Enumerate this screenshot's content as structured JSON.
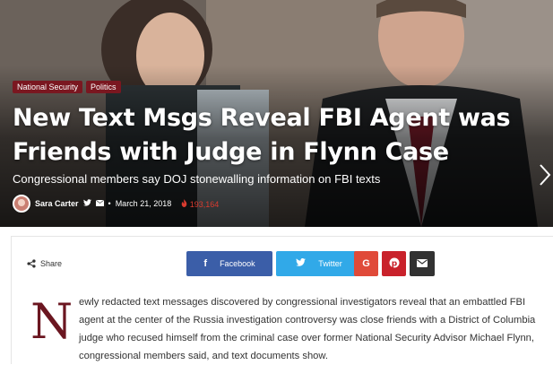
{
  "hero": {
    "categories": [
      "National Security",
      "Politics"
    ],
    "title": "New Text Msgs Reveal FBI Agent was Friends with Judge in Flynn Case",
    "subtitle": "Congressional members say DOJ stonewalling information on FBI texts",
    "author": "Sara Carter",
    "date": "March 21, 2018",
    "views": "193,164",
    "next_icon": "chevron-right-icon"
  },
  "share": {
    "label": "Share",
    "facebook": "Facebook",
    "twitter": "Twitter"
  },
  "article": {
    "dropcap": "N",
    "paragraph": "ewly redacted text messages discovered by congressional investigators reveal that an embattled FBI agent at the center of the Russia investigation controversy was close friends with a District of Columbia judge who recused himself from the criminal case over former National Security Advisor Michael Flynn, congressional members said, and text documents show."
  },
  "colors": {
    "category_bg": "#7a1720",
    "facebook": "#3b5ea8",
    "twitter": "#31a9e8",
    "google_plus": "#e04a39",
    "pinterest": "#c9222b",
    "email": "#323232",
    "dropcap": "#6b1620",
    "views": "#d83b2f"
  }
}
